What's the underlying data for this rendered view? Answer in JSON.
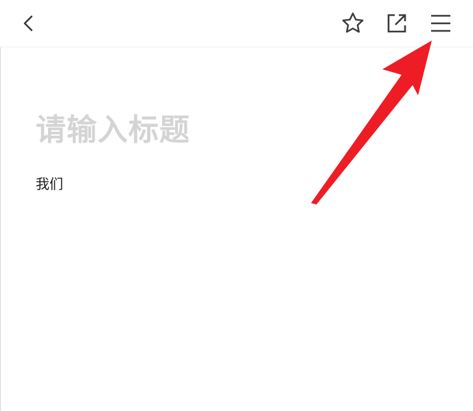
{
  "toolbar": {
    "back_icon": "chevron-left-icon",
    "favorite_icon": "star-icon",
    "share_icon": "external-link-icon",
    "menu_icon": "hamburger-menu-icon"
  },
  "editor": {
    "title_placeholder": "请输入标题",
    "body_text": "我们"
  },
  "annotation": {
    "arrow_color": "#ee1c25",
    "points_to": "menu-button"
  },
  "colors": {
    "icon_color": "#3a3a3a",
    "placeholder_color": "#d4d4d4",
    "text_color": "#1c1c1c"
  }
}
